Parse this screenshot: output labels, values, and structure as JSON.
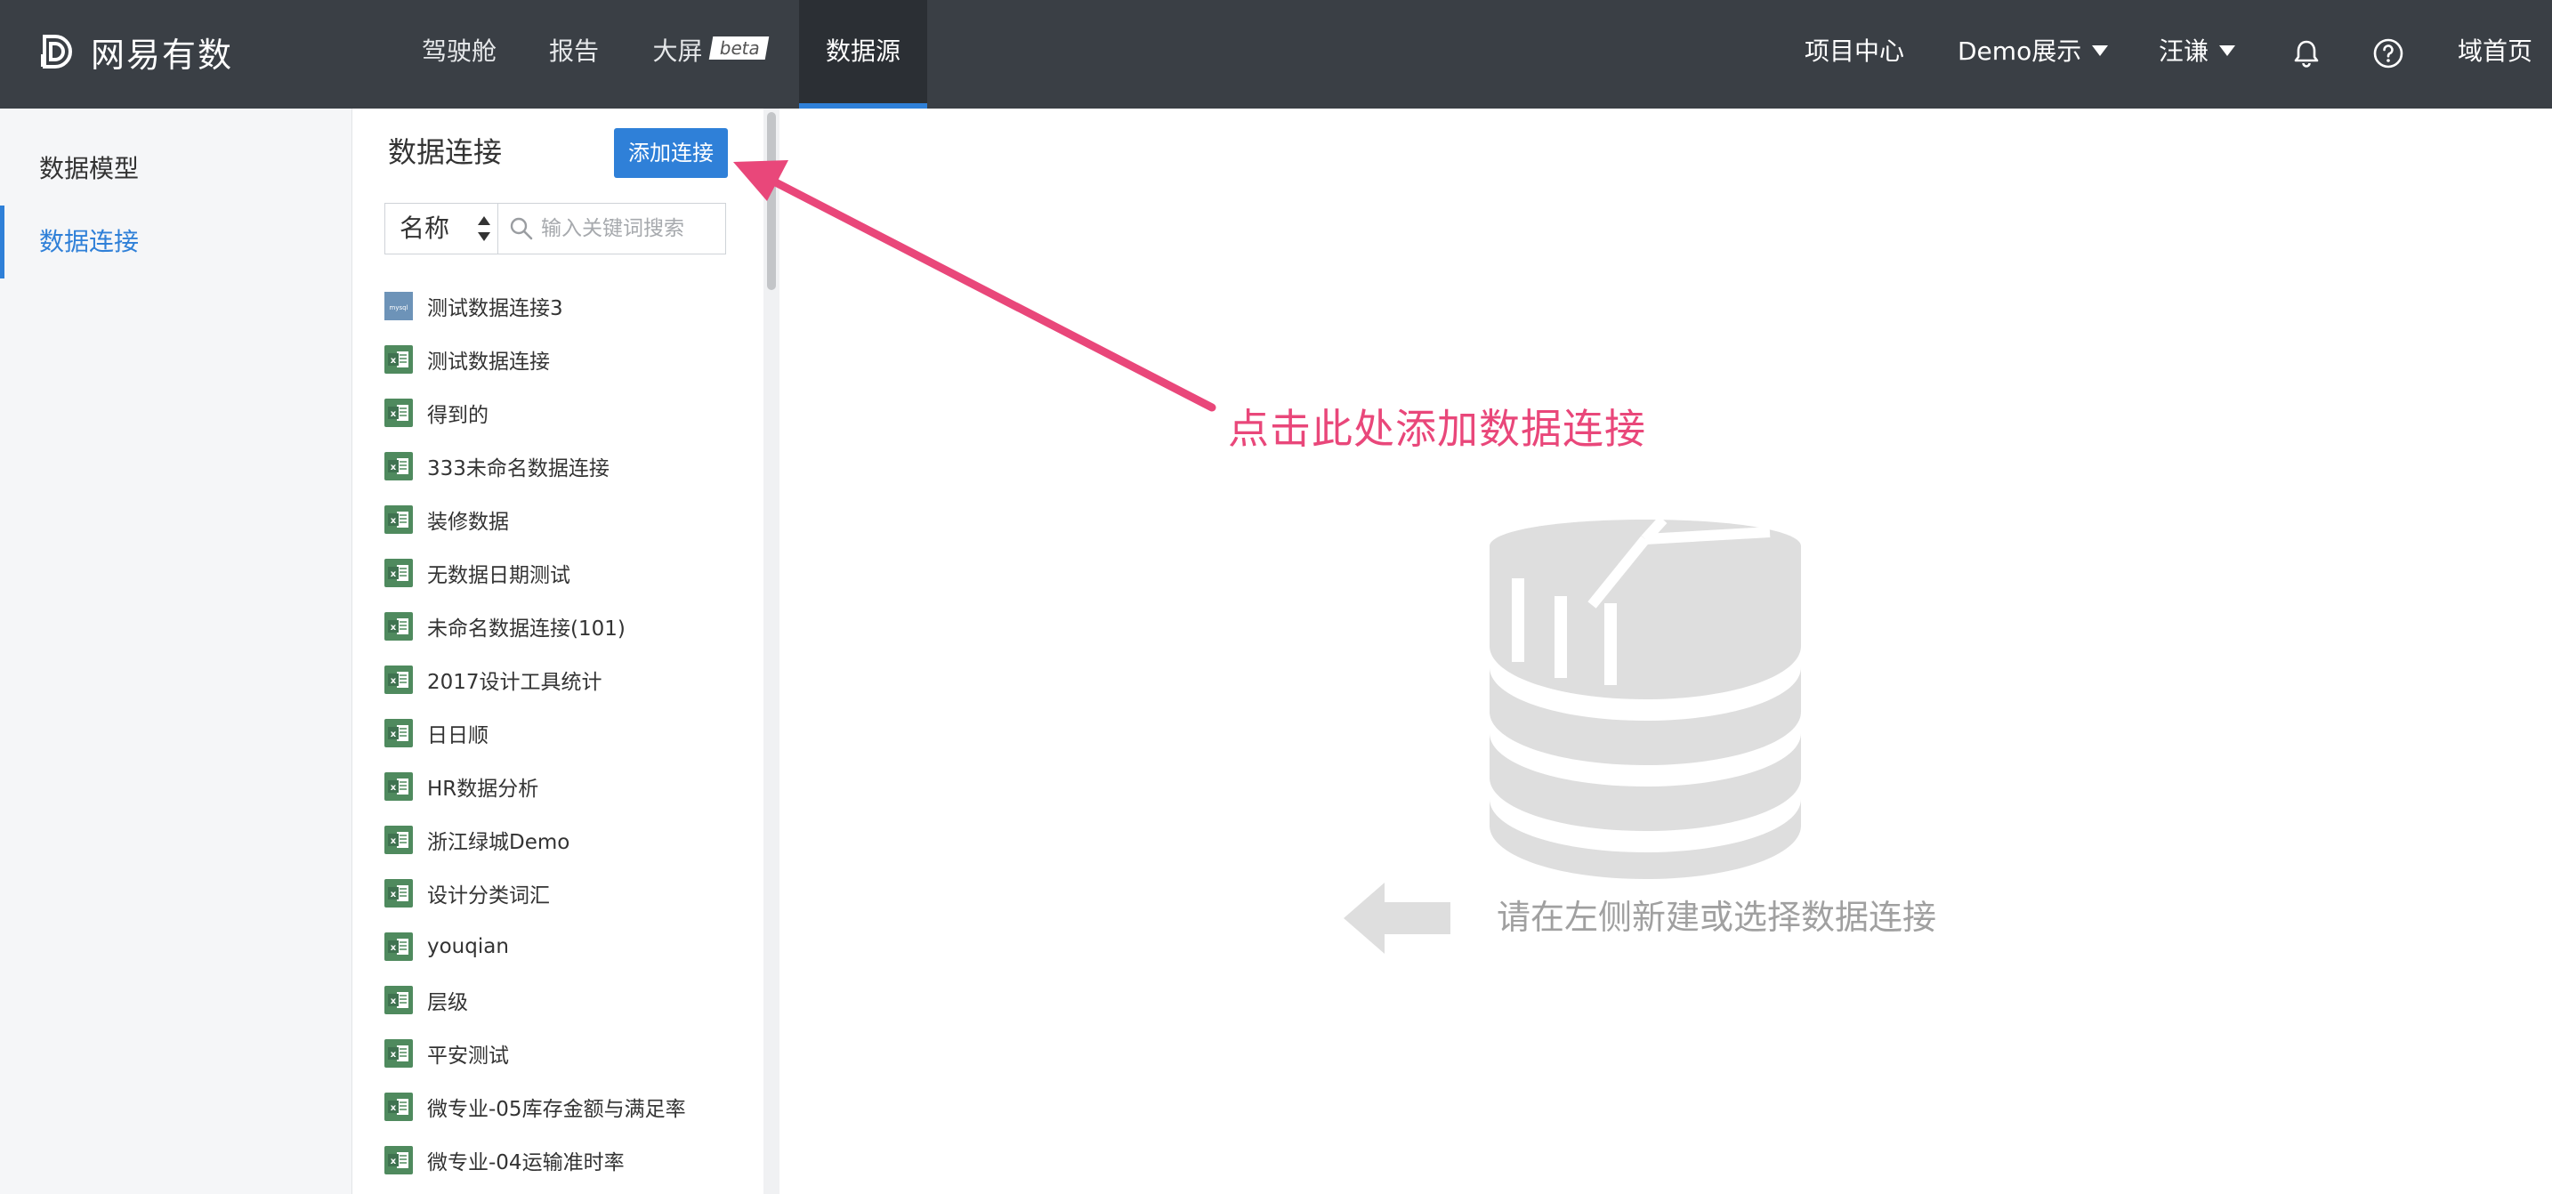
{
  "header": {
    "logo_text": "网易有数",
    "nav": [
      {
        "label": "驾驶舱",
        "active": false
      },
      {
        "label": "报告",
        "active": false
      },
      {
        "label": "大屏",
        "badge": "beta",
        "active": false
      },
      {
        "label": "数据源",
        "active": true
      }
    ],
    "right": {
      "project_center": "项目中心",
      "project_dropdown": "Demo展示",
      "user_dropdown": "汪谦",
      "bell_icon": "bell-icon",
      "help_icon": "help-icon",
      "home_link": "域首页"
    }
  },
  "sidebar": {
    "items": [
      {
        "label": "数据模型",
        "active": false
      },
      {
        "label": "数据连接",
        "active": true
      }
    ]
  },
  "panel": {
    "title": "数据连接",
    "add_button": "添加连接",
    "sort_select": "名称",
    "search_placeholder": "输入关键词搜索",
    "connections": [
      {
        "label": "测试数据连接3",
        "type": "mysql"
      },
      {
        "label": "测试数据连接",
        "type": "excel"
      },
      {
        "label": "得到的",
        "type": "excel"
      },
      {
        "label": "333未命名数据连接",
        "type": "excel"
      },
      {
        "label": "装修数据",
        "type": "excel"
      },
      {
        "label": "无数据日期测试",
        "type": "excel"
      },
      {
        "label": "未命名数据连接(101)",
        "type": "excel"
      },
      {
        "label": "2017设计工具统计",
        "type": "excel"
      },
      {
        "label": "日日顺",
        "type": "excel"
      },
      {
        "label": "HR数据分析",
        "type": "excel"
      },
      {
        "label": "浙江绿城Demo",
        "type": "excel"
      },
      {
        "label": "设计分类词汇",
        "type": "excel"
      },
      {
        "label": "youqian",
        "type": "excel"
      },
      {
        "label": "层级",
        "type": "excel"
      },
      {
        "label": "平安测试",
        "type": "excel"
      },
      {
        "label": "微专业-05库存金额与满足率",
        "type": "excel"
      },
      {
        "label": "微专业-04运输准时率",
        "type": "excel"
      }
    ]
  },
  "main": {
    "annotation": "点击此处添加数据连接",
    "empty_text": "请在左侧新建或选择数据连接"
  },
  "colors": {
    "topbar": "#3a3f45",
    "accent": "#2f80d8",
    "annotation": "#e9477a",
    "excel_icon": "#4f8a5e",
    "placeholder_graphic": "#dedede"
  }
}
